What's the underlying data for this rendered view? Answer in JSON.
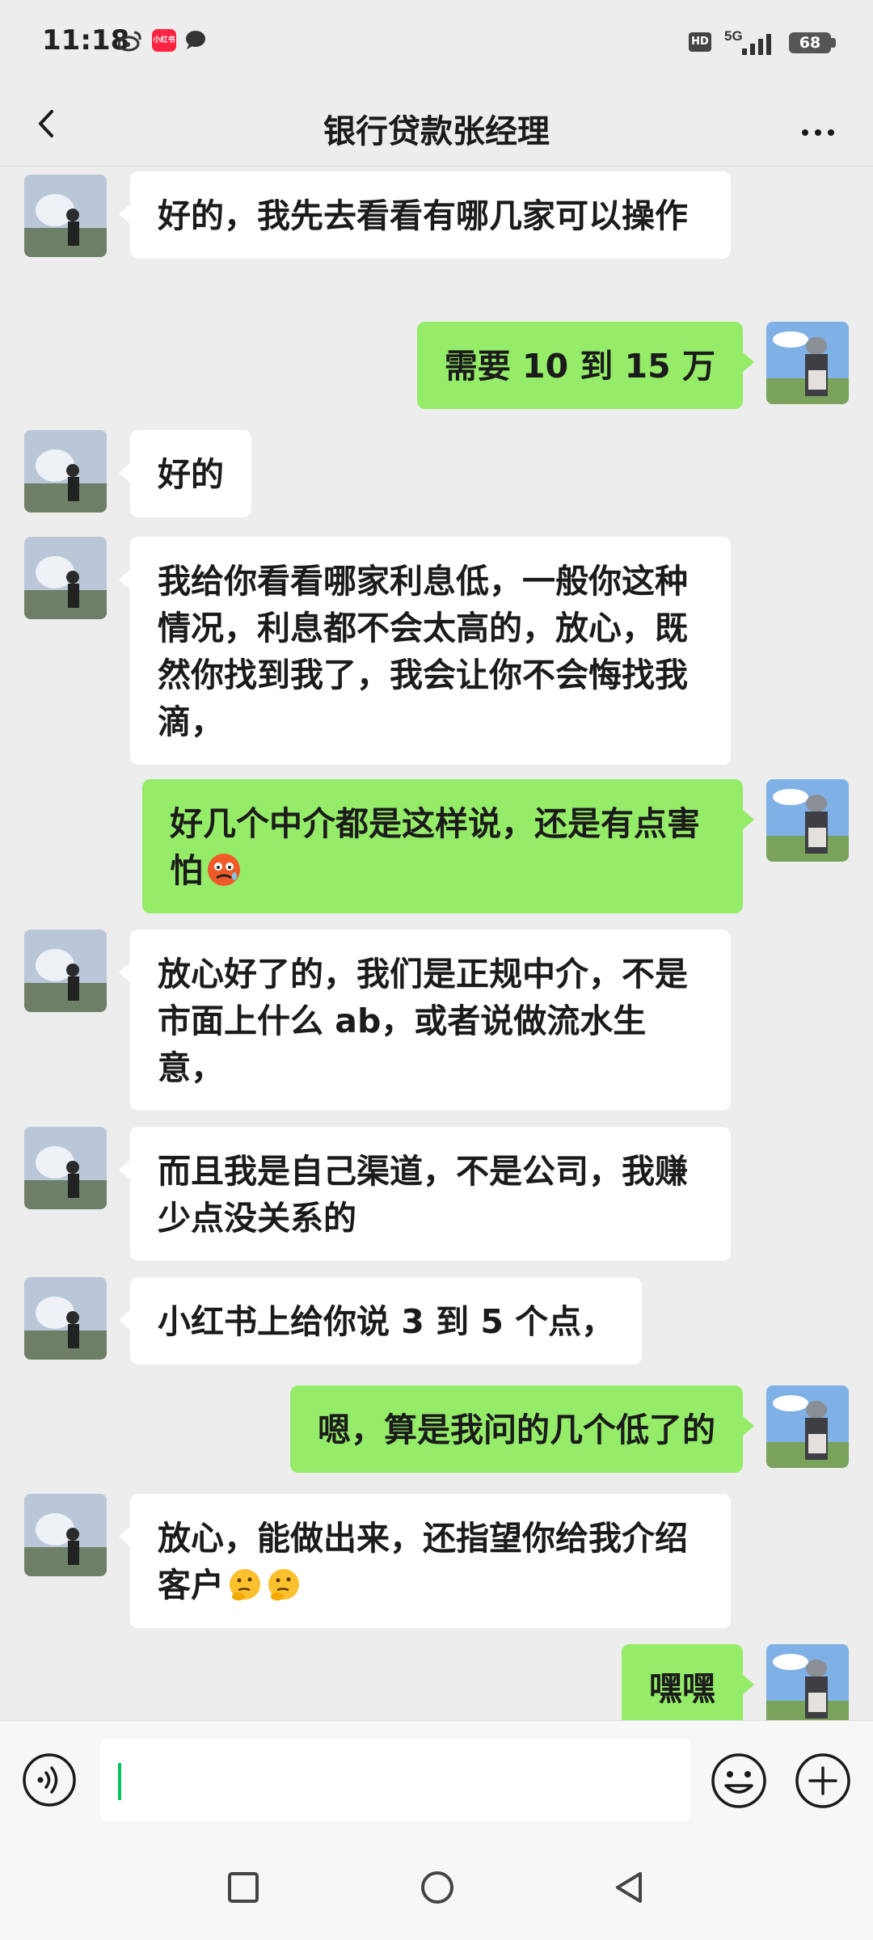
{
  "status_bar": {
    "time": "11:18",
    "notif_badge": "小红书",
    "hd": "HD",
    "network": "5G",
    "battery": "68"
  },
  "header": {
    "title": "银行贷款张经理",
    "back_icon": "chevron-left-icon",
    "more_icon": "more-dots-icon"
  },
  "colors": {
    "background": "#ededed",
    "sent_bubble": "#95ec69",
    "received_bubble": "#ffffff",
    "cursor": "#07c160"
  },
  "messages": [
    {
      "side": "left",
      "text": "好的，我先去看看有哪几家可以操作"
    },
    {
      "side": "right",
      "text": "需要 10 到 15 万"
    },
    {
      "side": "left",
      "text": "好的"
    },
    {
      "side": "left",
      "text": "我给你看看哪家利息低，一般你这种情况，利息都不会太高的，放心，既然你找到我了，我会让你不会悔找我滴，"
    },
    {
      "side": "right",
      "text": "好几个中介都是这样说，还是有点害怕",
      "emoji": "fearful-face-emoji"
    },
    {
      "side": "left",
      "text": "放心好了的，我们是正规中介，不是市面上什么 ab，或者说做流水生意，"
    },
    {
      "side": "left",
      "text": "而且我是自己渠道，不是公司，我赚少点没关系的"
    },
    {
      "side": "left",
      "text": "小红书上给你说 3 到 5 个点，"
    },
    {
      "side": "right",
      "text": "嗯，算是我问的几个低了的"
    },
    {
      "side": "left",
      "text": "放心，能做出来，还指望你给我介绍客户",
      "emoji": "thinking-face-emoji"
    },
    {
      "side": "right",
      "text": "嘿嘿"
    }
  ],
  "input_bar": {
    "voice_icon": "voice-icon",
    "emoji_icon": "smiley-icon",
    "plus_icon": "plus-icon",
    "value": ""
  },
  "nav_bar": {
    "recent_icon": "square-icon",
    "home_icon": "circle-icon",
    "back_icon": "triangle-back-icon"
  }
}
